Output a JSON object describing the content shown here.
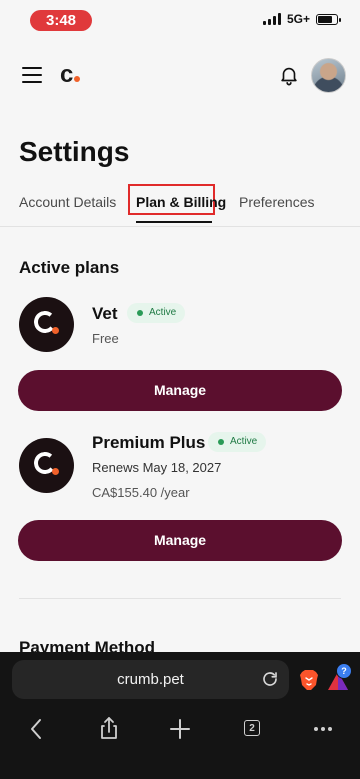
{
  "status_bar": {
    "time": "3:48",
    "network": "5G+"
  },
  "header": {
    "logo_text": "c"
  },
  "page": {
    "title": "Settings"
  },
  "tabs": [
    {
      "label": "Account Details",
      "active": false
    },
    {
      "label": "Plan & Billing",
      "active": true
    },
    {
      "label": "Preferences",
      "active": false
    }
  ],
  "active_plans": {
    "title": "Active plans",
    "plans": [
      {
        "name": "Vet",
        "status": "Active",
        "detail": "Free",
        "button": "Manage"
      },
      {
        "name": "Premium Plus",
        "status": "Active",
        "detail": "Renews May 18, 2027",
        "price": "CA$155.40 /year",
        "button": "Manage"
      }
    ]
  },
  "payment": {
    "title": "Payment Method"
  },
  "browser": {
    "url": "crumb.pet",
    "tab_count": "2",
    "rewards_badge": "?"
  },
  "colors": {
    "primary": "#5b0f2e",
    "accent": "#f0612a",
    "highlight": "#e02a2a",
    "active_badge": "#1f7a44"
  },
  "icons": [
    "menu-icon",
    "bell-icon",
    "reload-icon",
    "brave-lion-icon",
    "brave-rewards-icon",
    "back-icon",
    "share-icon",
    "plus-icon",
    "tabs-icon",
    "more-icon"
  ]
}
